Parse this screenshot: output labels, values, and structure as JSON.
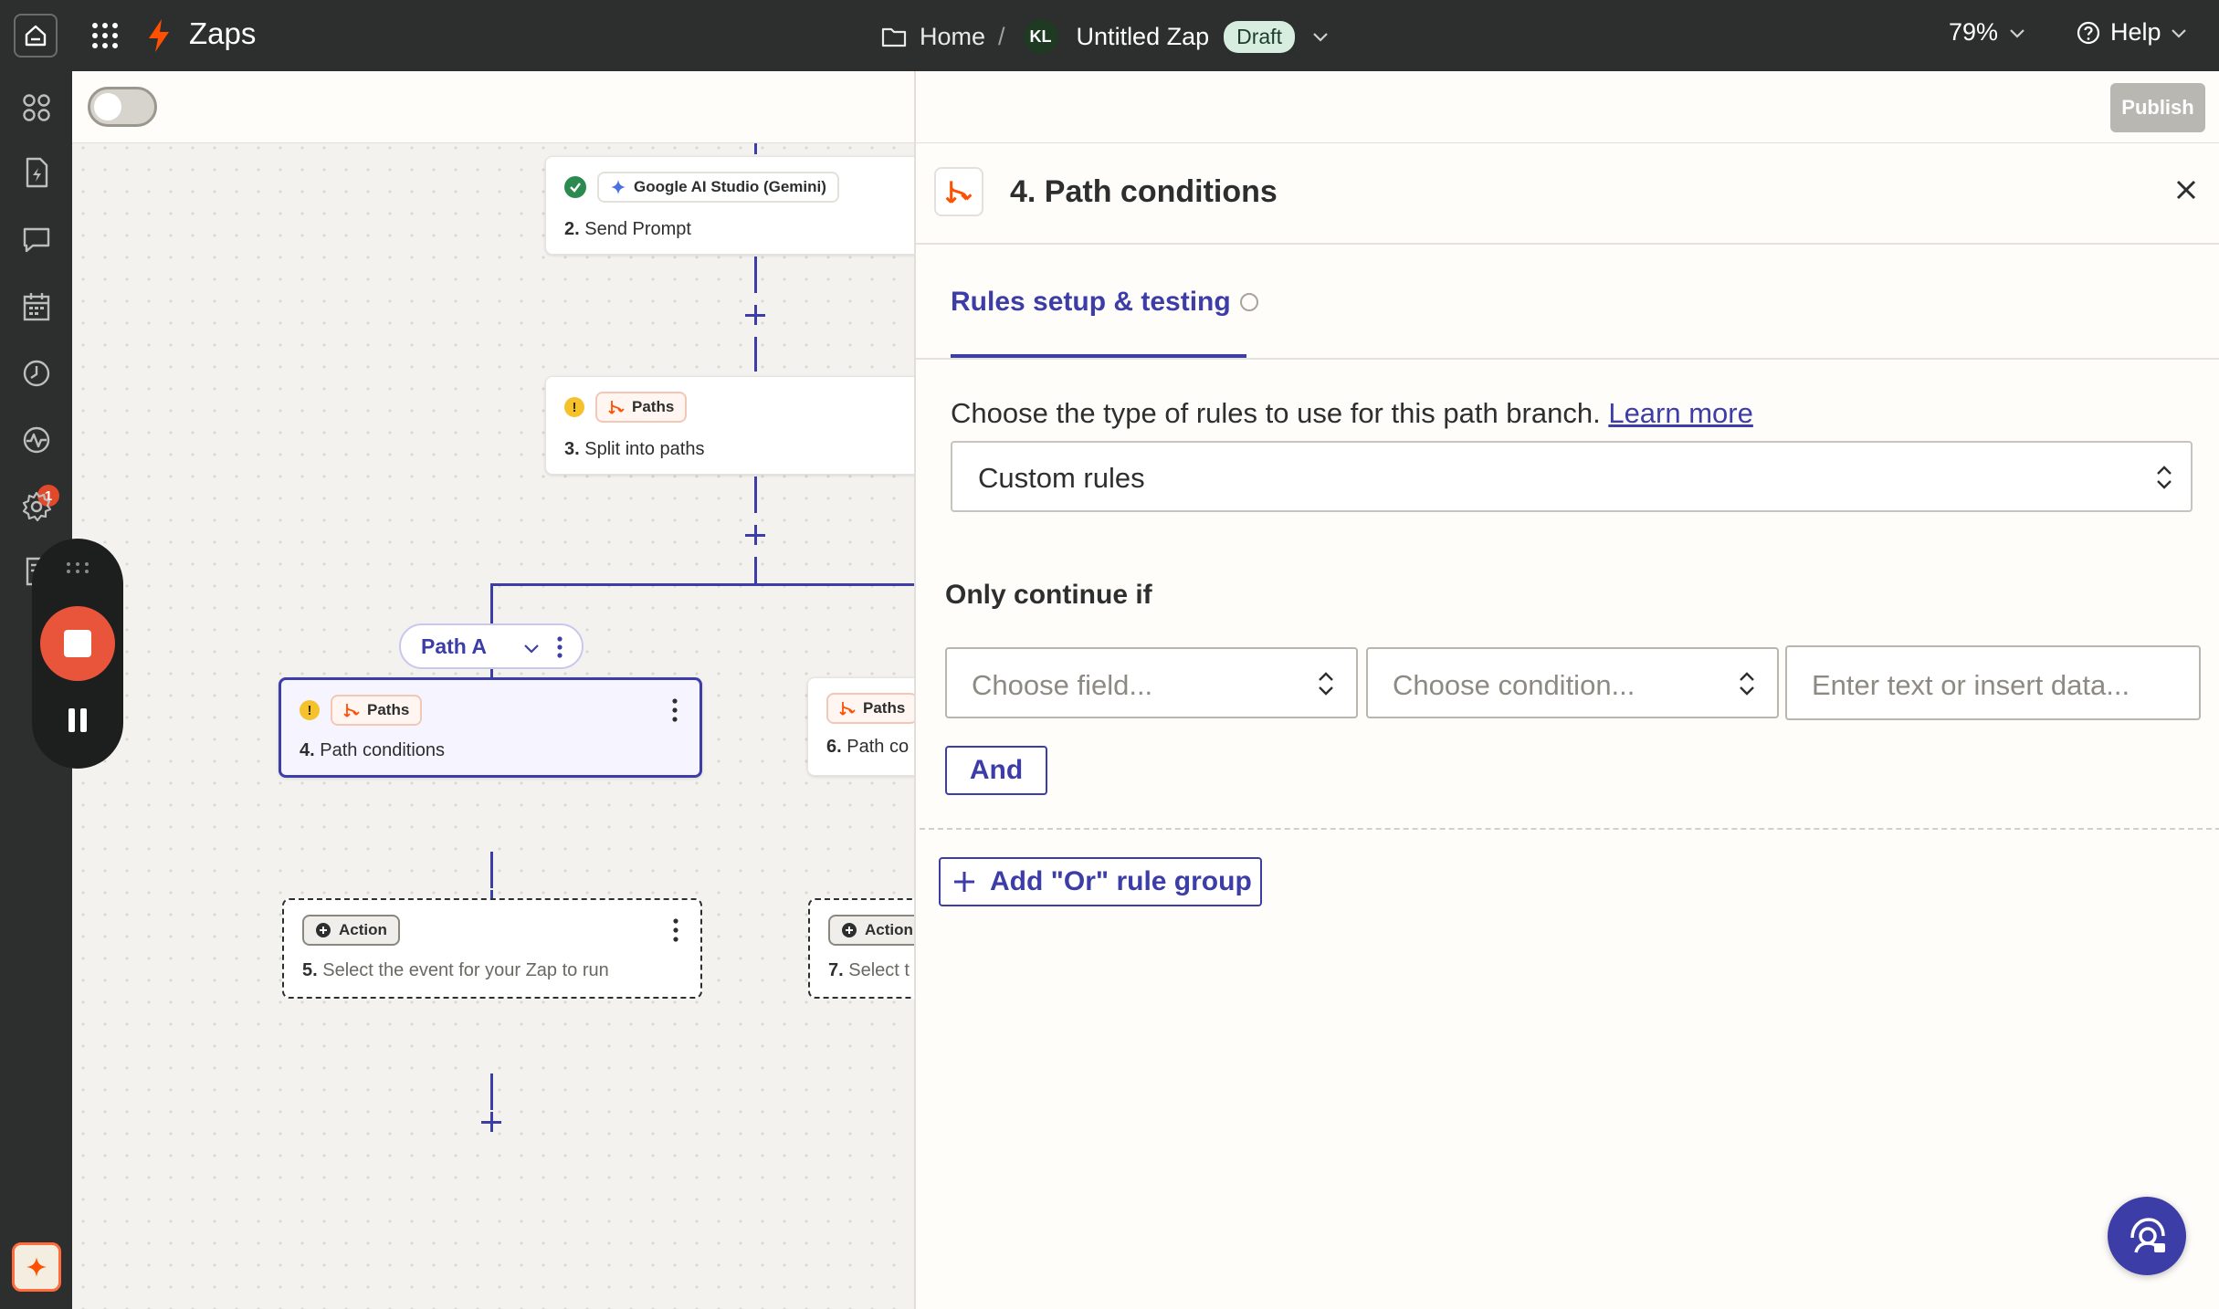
{
  "topbar": {
    "app_title": "Zaps",
    "breadcrumb_home": "Home",
    "breadcrumb_sep": "/",
    "avatar_initials": "KL",
    "zap_name": "Untitled Zap",
    "status_badge": "Draft",
    "zoom": "79%",
    "help": "Help"
  },
  "rail": {
    "icons": [
      "apps-icon",
      "zap-file-icon",
      "chat-icon",
      "calendar-icon",
      "history-icon",
      "activity-icon",
      "settings-icon",
      "docs-icon",
      "ai-sparkle-icon"
    ],
    "notification_count": "1"
  },
  "editor": {
    "publish_label": "Publish"
  },
  "canvas": {
    "steps": [
      {
        "app": "Google AI Studio (Gemini)",
        "number": "2.",
        "title": "Send Prompt",
        "status": "ok"
      },
      {
        "app": "Paths",
        "number": "3.",
        "title": "Split into paths",
        "status": "warning"
      },
      {
        "app": "Paths",
        "number": "4.",
        "title": "Path conditions",
        "status": "warning",
        "selected": true
      },
      {
        "app": "Paths",
        "number": "6.",
        "title": "Path co"
      },
      {
        "app": "Action",
        "number": "5.",
        "title": "Select the event for your Zap to run"
      },
      {
        "app": "Action",
        "number": "7.",
        "title": "Select t"
      }
    ],
    "path_chip": "Path A"
  },
  "panel": {
    "heading": "4. Path conditions",
    "tab": "Rules setup & testing",
    "intro_text": "Choose the type of rules to use for this path branch.",
    "intro_link": "Learn more",
    "rule_type_value": "Custom rules",
    "only_continue_label": "Only continue if",
    "field_placeholder": "Choose field...",
    "condition_placeholder": "Choose condition...",
    "value_placeholder": "Enter text or insert data...",
    "and_label": "And",
    "or_group_label": "Add \"Or\" rule group"
  },
  "colors": {
    "accent": "#3d3da8",
    "brand_orange": "#ff4f00",
    "topbar_bg": "#2d2e2e",
    "warning": "#f5c22d",
    "success": "#2b8a4f"
  }
}
